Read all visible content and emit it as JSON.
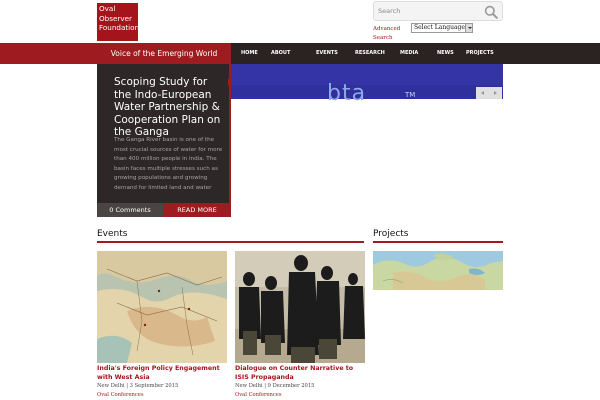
{
  "header": {
    "logo_lines": [
      "Oval",
      "Observer",
      "Foundation"
    ],
    "search_placeholder": "Search",
    "advanced_search": "Advanced Search",
    "language_selected": "Select Language"
  },
  "nav": {
    "tagline": "Voice of the Emerging World",
    "items": [
      "HOME",
      "ABOUT US",
      "EVENTS",
      "RESEARCH",
      "MEDIA",
      "NEWS",
      "PROJECTS"
    ]
  },
  "slider": {
    "image_text": "bta",
    "image_mark": "TM",
    "feature": {
      "title": "Scoping Study for the Indo-European Water Partnership & Cooperation Plan on the Ganga",
      "excerpt": "The Ganga River basin is one of the most crucial sources of water for more than 400 million people in India. The basin faces multiple stresses such as growing populations and growing demand for limited land and water",
      "comments_label": "0 Comments",
      "read_more_label": "READ MORE"
    }
  },
  "events": {
    "heading": "Events",
    "items": [
      {
        "title": "India's Foreign Policy Engagement with West Asia",
        "meta": "New Delhi | 3 September 2015",
        "category": "Oval Conferences"
      },
      {
        "title": "Dialogue on Counter Narrative to ISIS Propaganda",
        "meta": "New Delhi | 9 December 2015",
        "category": "Oval Conferences"
      }
    ]
  },
  "projects": {
    "heading": "Projects"
  },
  "colors": {
    "brand_red": "#9e1c20",
    "nav_dark": "#2b2222",
    "feature_bg": "#2d2727",
    "slider_blue": "#2f2f9e"
  }
}
